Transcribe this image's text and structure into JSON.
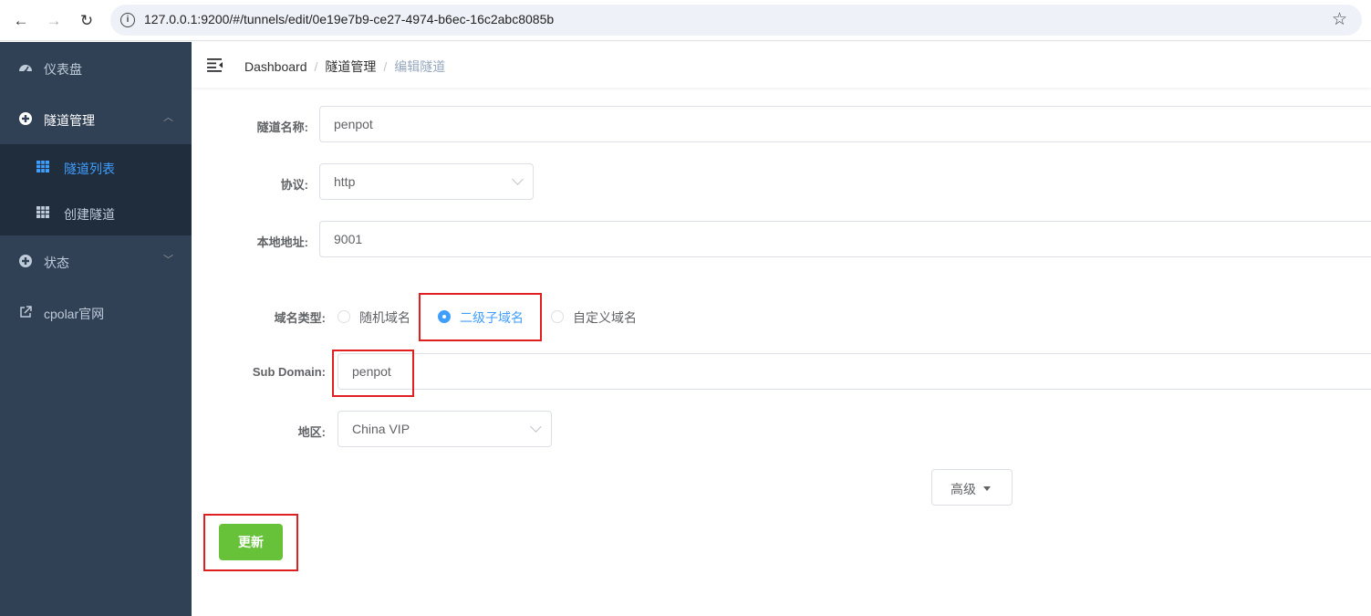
{
  "browser": {
    "url": "127.0.0.1:9200/#/tunnels/edit/0e19e7b9-ce27-4974-b6ec-16c2abc8085b"
  },
  "sidebar": {
    "items": [
      {
        "label": "仪表盘",
        "icon": "dashboard-icon"
      },
      {
        "label": "隧道管理",
        "icon": "tunnel-icon",
        "expanded": true,
        "children": [
          {
            "label": "隧道列表",
            "icon": "table-icon",
            "active": true
          },
          {
            "label": "创建隧道",
            "icon": "table-icon"
          }
        ]
      },
      {
        "label": "状态",
        "icon": "status-icon"
      },
      {
        "label": "cpolar官网",
        "icon": "external-link-icon"
      }
    ]
  },
  "header": {
    "breadcrumb": [
      "Dashboard",
      "隧道管理",
      "编辑隧道"
    ]
  },
  "form": {
    "name_label": "隧道名称:",
    "name_value": "penpot",
    "protocol_label": "协议:",
    "protocol_value": "http",
    "local_label": "本地地址:",
    "local_value": "9001",
    "domain_type_label": "域名类型:",
    "domain_type_options": [
      "随机域名",
      "二级子域名",
      "自定义域名"
    ],
    "domain_type_selected": "二级子域名",
    "subdomain_label": "Sub Domain:",
    "subdomain_value": "penpot",
    "region_label": "地区:",
    "region_value": "China VIP",
    "advanced_label": "高级",
    "update_label": "更新"
  },
  "colors": {
    "sidebar_bg": "#304156",
    "submenu_bg": "#1f2d3d",
    "active_blue": "#409eff",
    "success_green": "#67c23a",
    "highlight_red": "#e02020"
  }
}
